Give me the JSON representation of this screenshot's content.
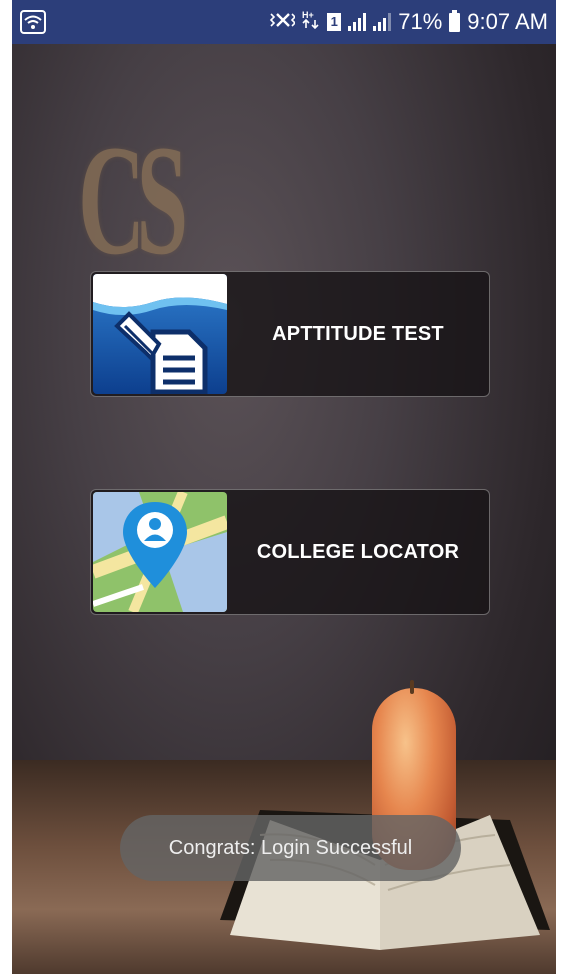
{
  "status_bar": {
    "battery_percent": "71%",
    "time": "9:07 AM",
    "sim_slot": "1",
    "icons": [
      "wifi-icon",
      "mute-vibrate-icon",
      "data-arrows-icon",
      "sim-icon",
      "signal-icon",
      "signal-icon",
      "battery-icon"
    ]
  },
  "background": {
    "logo_text": "CS"
  },
  "menu": {
    "aptitude": {
      "label": "APTTITUDE TEST",
      "icon": "document-edit-icon"
    },
    "college": {
      "label": "COLLEGE LOCATOR",
      "icon": "map-pin-icon"
    }
  },
  "toast": {
    "message": "Congrats: Login Successful"
  },
  "colors": {
    "status_bar": "#2c3e7a",
    "button_bg": "#16121499"
  }
}
